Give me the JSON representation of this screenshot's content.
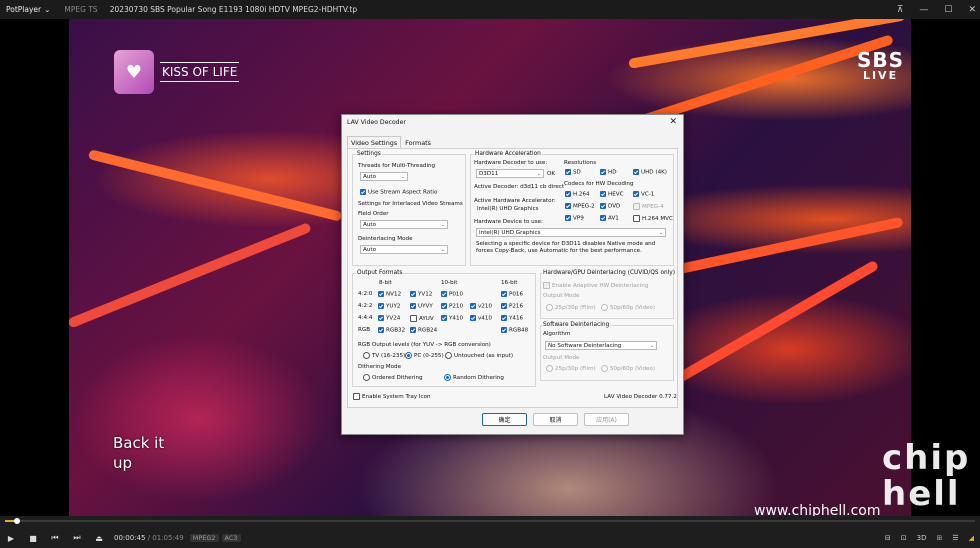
{
  "titlebar": {
    "app": "PotPlayer",
    "format": "MPEG TS",
    "file": "20230730 SBS Popular Song E1193 1080i HDTV MPEG2-HDHTV.tp"
  },
  "overlay": {
    "logo_text": "Kiss of Life",
    "brand_text": "KISS OF LIFE",
    "network": "SBS",
    "network_sub": "LIVE",
    "lyric_line1": "Back it",
    "lyric_line2": "up",
    "watermark": "www.chiphell.com",
    "watermark_logo": "chip hell"
  },
  "player": {
    "time_current": "00:00:45",
    "time_total": "/ 01:05:49",
    "tag_video": "MPEG2",
    "tag_audio": "AC3",
    "progress": 0.012,
    "right_labels": [
      "3D",
      "☰"
    ]
  },
  "dialog": {
    "title": "LAV Video Decoder",
    "tabs": [
      "Video Settings",
      "Formats"
    ],
    "settings": {
      "label": "Settings",
      "threads_label": "Threads for Multi-Threading",
      "threads_value": "Auto",
      "stream_aspect": "Use Stream Aspect Ratio",
      "interlaced_label": "Settings for Interlaced Video Streams",
      "field_order_label": "Field Order",
      "field_order_value": "Auto",
      "deint_mode_label": "Deinterlacing Mode",
      "deint_mode_value": "Auto"
    },
    "hwaccel": {
      "label": "Hardware Acceleration",
      "decoder_label": "Hardware Decoder to use:",
      "decoder_value": "D3D11",
      "decoder_status": "OK",
      "active_decoder": "Active Decoder:  d3d11 cb direct",
      "active_accel_label": "Active Hardware Accelerator:",
      "active_accel_value": "Intel(R) UHD Graphics",
      "device_label": "Hardware Device to use:",
      "device_value": "Intel(R) UHD Graphics",
      "device_note": "Selecting a specific device for D3D11 disables Native mode and forces Copy-Back, use Automatic for the best performance.",
      "resolutions_label": "Resolutions",
      "resolutions": [
        {
          "name": "SD",
          "checked": true
        },
        {
          "name": "HD",
          "checked": true
        },
        {
          "name": "UHD (4K)",
          "checked": true
        }
      ],
      "codecs_label": "Codecs for HW Decoding",
      "codecs": [
        {
          "name": "H.264",
          "state": "on"
        },
        {
          "name": "HEVC",
          "state": "on"
        },
        {
          "name": "VC-1",
          "state": "on"
        },
        {
          "name": "MPEG-2",
          "state": "on"
        },
        {
          "name": "DVD",
          "state": "on"
        },
        {
          "name": "MPEG-4",
          "state": "dis"
        },
        {
          "name": "VP9",
          "state": "on"
        },
        {
          "name": "AV1",
          "state": "on"
        },
        {
          "name": "H.264 MVC",
          "state": "off"
        }
      ]
    },
    "output": {
      "label": "Output Formats",
      "col_8bit": "8-bit",
      "col_10bit": "10-bit",
      "col_16bit": "16-bit",
      "rows": [
        {
          "label": "4:2:0",
          "items": [
            {
              "name": "NV12",
              "state": "on"
            },
            {
              "name": "YV12",
              "state": "on"
            },
            {
              "name": "P010",
              "state": "on"
            },
            {
              "name": "P016",
              "state": "on"
            }
          ]
        },
        {
          "label": "4:2:2",
          "items": [
            {
              "name": "YUY2",
              "state": "on"
            },
            {
              "name": "UYVY",
              "state": "on"
            },
            {
              "name": "P210",
              "state": "on"
            },
            {
              "name": "v210",
              "state": "on"
            },
            {
              "name": "P216",
              "state": "on"
            }
          ]
        },
        {
          "label": "4:4:4",
          "items": [
            {
              "name": "YV24",
              "state": "on"
            },
            {
              "name": "AYUV",
              "state": "off"
            },
            {
              "name": "Y410",
              "state": "on"
            },
            {
              "name": "v410",
              "state": "on"
            },
            {
              "name": "Y416",
              "state": "on"
            }
          ]
        },
        {
          "label": "RGB",
          "items": [
            {
              "name": "RGB32",
              "state": "on"
            },
            {
              "name": "RGB24",
              "state": "on"
            },
            {
              "name": "RGB48",
              "state": "on"
            }
          ]
        }
      ],
      "levels_label": "RGB Output levels (for YUV -> RGB conversion)",
      "levels": [
        {
          "name": "TV (16-235)",
          "on": false
        },
        {
          "name": "PC (0-255)",
          "on": true
        },
        {
          "name": "Untouched (as input)",
          "on": false
        }
      ],
      "dither_label": "Dithering Mode",
      "dither": [
        {
          "name": "Ordered Dithering",
          "on": false
        },
        {
          "name": "Random Dithering",
          "on": true
        }
      ]
    },
    "hwdeint": {
      "label": "Hardware/GPU Deinterlacing (CUVID/QS only)",
      "enable": "Enable Adaptive HW Deinterlacing",
      "output_mode": "Output Mode",
      "opt1": "25p/30p (Film)",
      "opt2": "50p/60p (Video)"
    },
    "swdeint": {
      "label": "Software Deinterlacing",
      "algorithm_label": "Algorithm",
      "algorithm_value": "No Software Deinterlacing",
      "output_mode": "Output Mode",
      "opt1": "25p/30p (Film)",
      "opt2": "50p/60p (Video)"
    },
    "tray": "Enable System Tray Icon",
    "version": "LAV Video Decoder 0.77.2",
    "buttons": {
      "ok": "确定",
      "cancel": "取消",
      "apply": "应用(A)"
    }
  }
}
